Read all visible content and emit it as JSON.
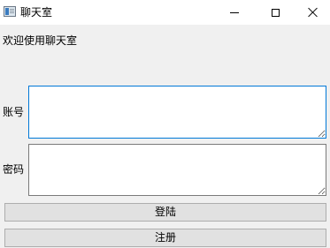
{
  "window": {
    "title": "聊天室"
  },
  "main": {
    "welcome_text": "欢迎使用聊天室",
    "account_label": "账号",
    "account_value": "",
    "password_label": "密码",
    "password_value": "",
    "login_label": "登陆",
    "register_label": "注册"
  },
  "colors": {
    "window_bg": "#f0f0f0",
    "focus_border": "#0078d7",
    "button_bg": "#e1e1e1",
    "button_border": "#adadad"
  }
}
